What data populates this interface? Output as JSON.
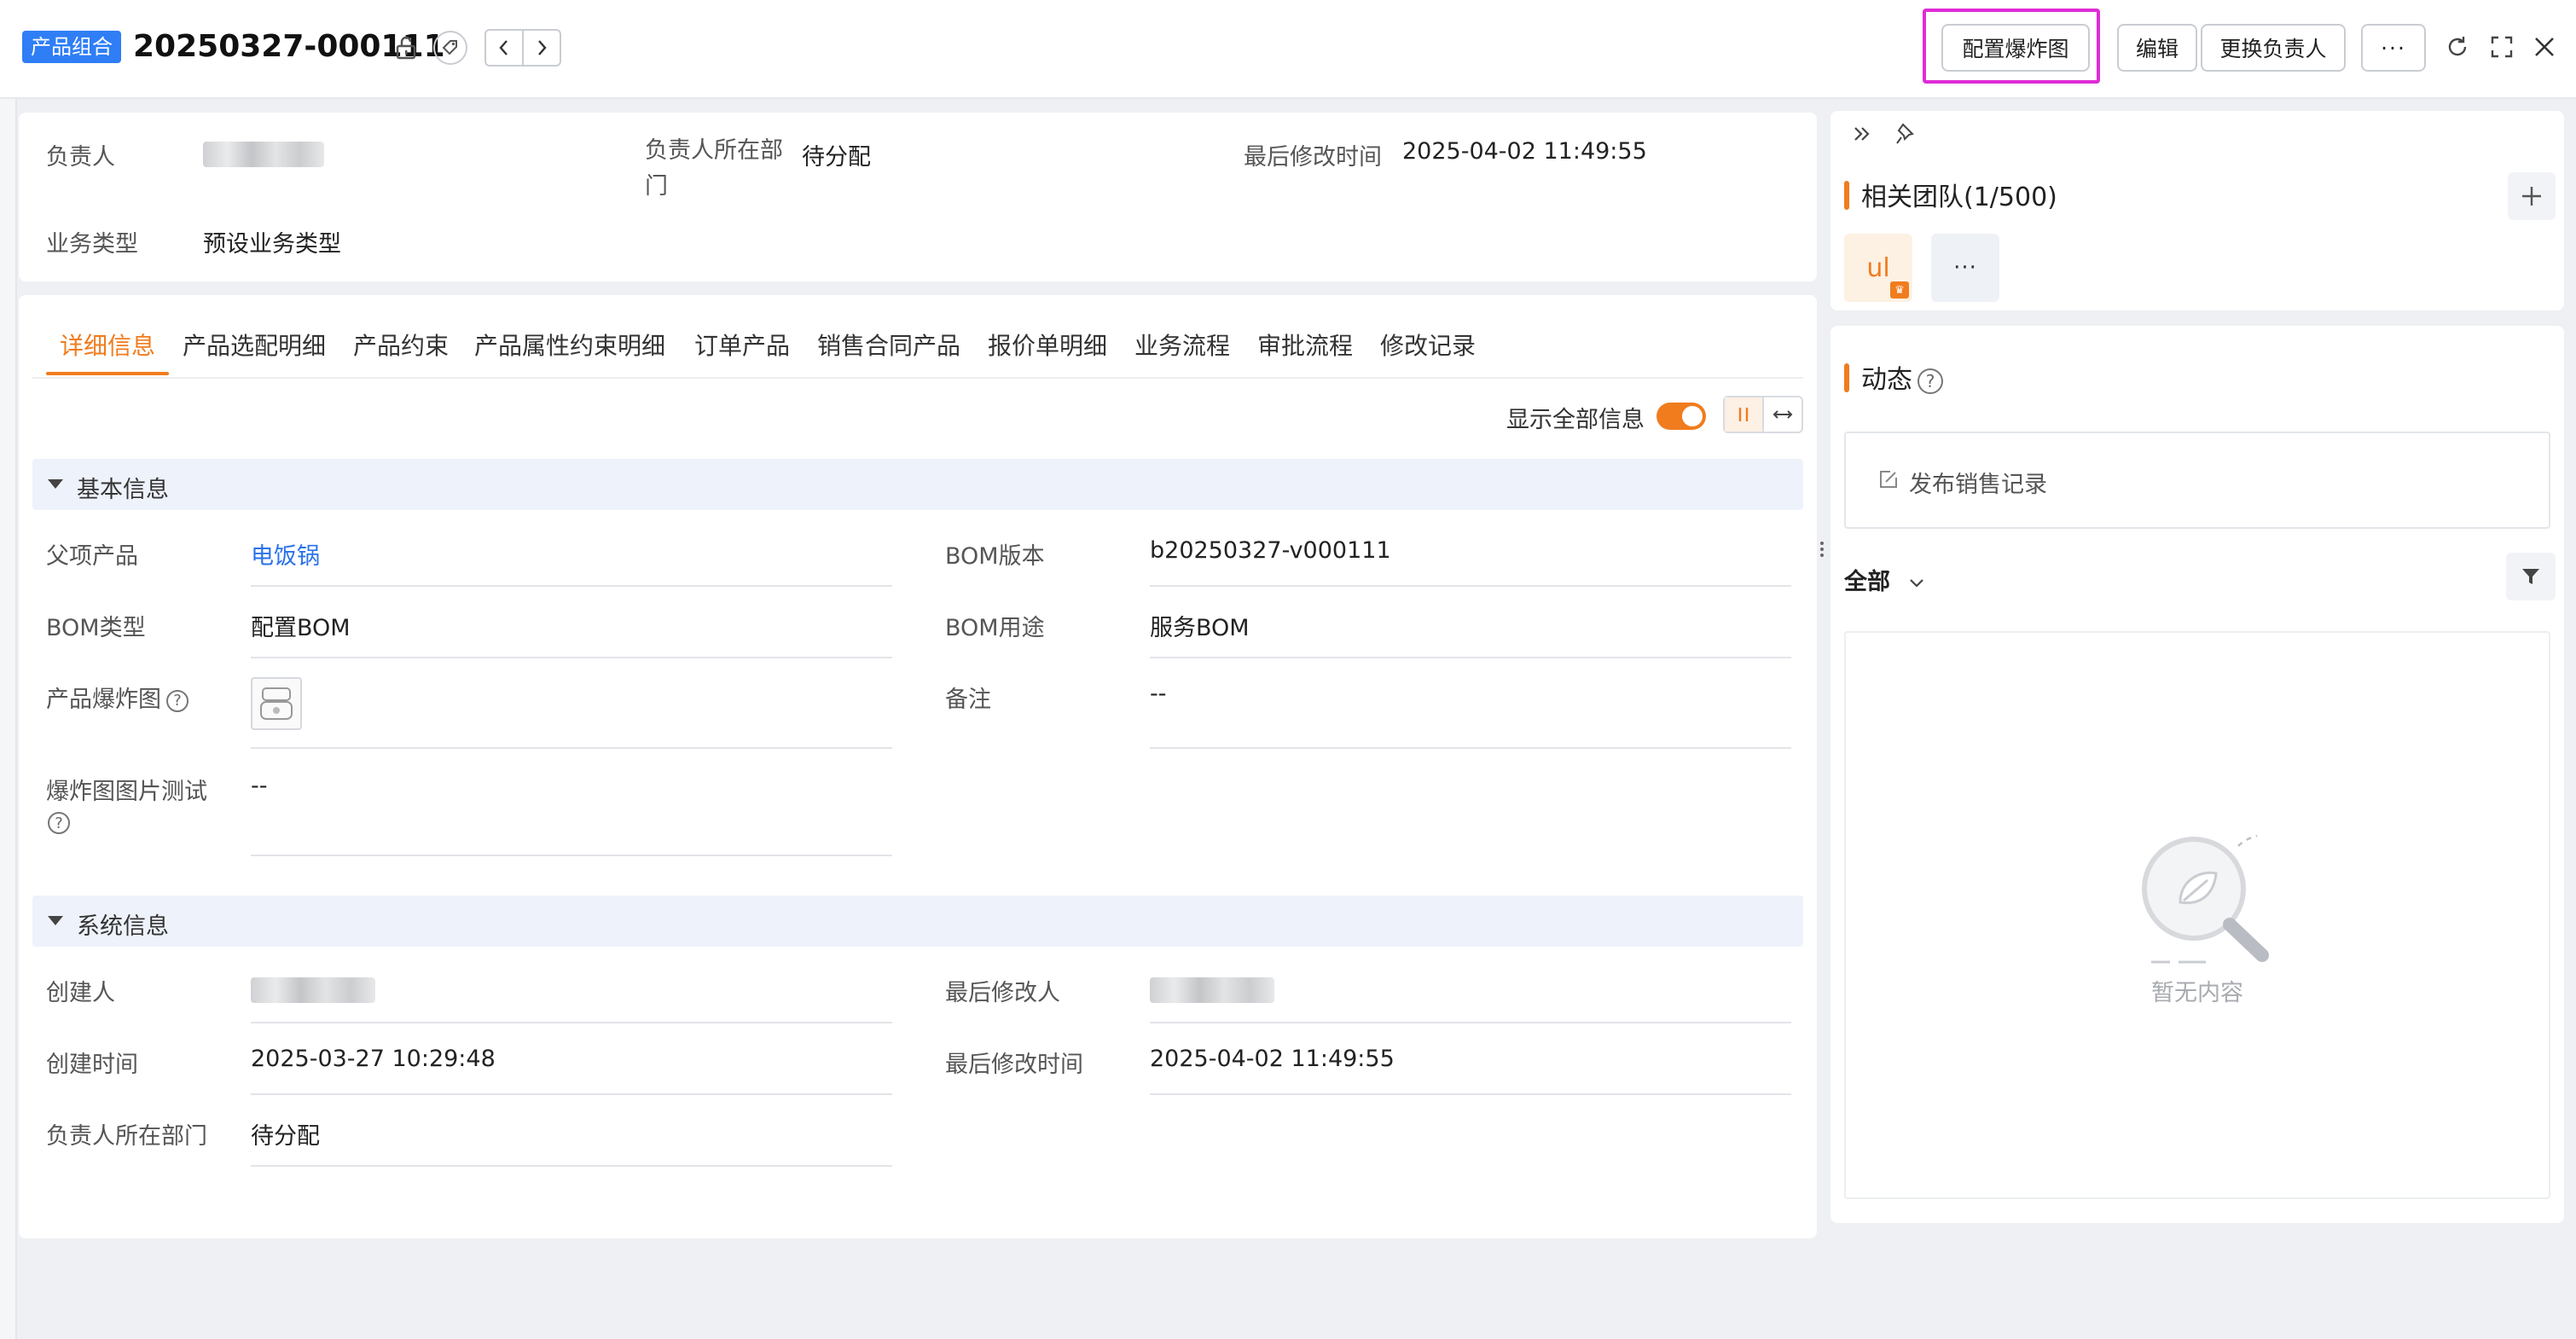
{
  "header": {
    "object_type_badge": "产品组合",
    "record_title": "20250327-000111",
    "buttons": {
      "configure_explosion": "配置爆炸图",
      "edit": "编辑",
      "change_owner": "更换负责人",
      "more": "···"
    }
  },
  "summary": {
    "owner_label": "负责人",
    "owner_dept_label": "负责人所在部门",
    "owner_dept_value": "待分配",
    "last_modified_label": "最后修改时间",
    "last_modified_value": "2025-04-02 11:49:55",
    "business_type_label": "业务类型",
    "business_type_value": "预设业务类型"
  },
  "tabs": [
    "详细信息",
    "产品选配明细",
    "产品约束",
    "产品属性约束明细",
    "订单产品",
    "销售合同产品",
    "报价单明细",
    "业务流程",
    "审批流程",
    "修改记录"
  ],
  "active_tab_index": 0,
  "show_all_label": "显示全部信息",
  "show_all_on": true,
  "sections": {
    "basic": {
      "title": "基本信息",
      "parent_product_label": "父项产品",
      "parent_product_value": "电饭锅",
      "bom_version_label": "BOM版本",
      "bom_version_value": "b20250327-v000111",
      "bom_type_label": "BOM类型",
      "bom_type_value": "配置BOM",
      "bom_usage_label": "BOM用途",
      "bom_usage_value": "服务BOM",
      "explosion_label": "产品爆炸图",
      "remark_label": "备注",
      "remark_value": "--",
      "explosion_test_label": "爆炸图图片测试",
      "explosion_test_value": "--"
    },
    "system": {
      "title": "系统信息",
      "creator_label": "创建人",
      "last_modifier_label": "最后修改人",
      "created_time_label": "创建时间",
      "created_time_value": "2025-03-27 10:29:48",
      "last_modified_label": "最后修改时间",
      "last_modified_value": "2025-04-02 11:49:55",
      "owner_dept_label": "负责人所在部门",
      "owner_dept_value": "待分配"
    }
  },
  "right_panel": {
    "team_title": "相关团队(1/500)",
    "member_initials": "ul",
    "more_members": "···",
    "activity_title": "动态",
    "post_label": "发布销售记录",
    "filter_label": "全部",
    "empty_text": "暂无内容"
  },
  "colors": {
    "accent": "#f07c1e",
    "badge": "#2f7ef6",
    "link": "#2a72e8",
    "highlight": "#e02bd6"
  }
}
